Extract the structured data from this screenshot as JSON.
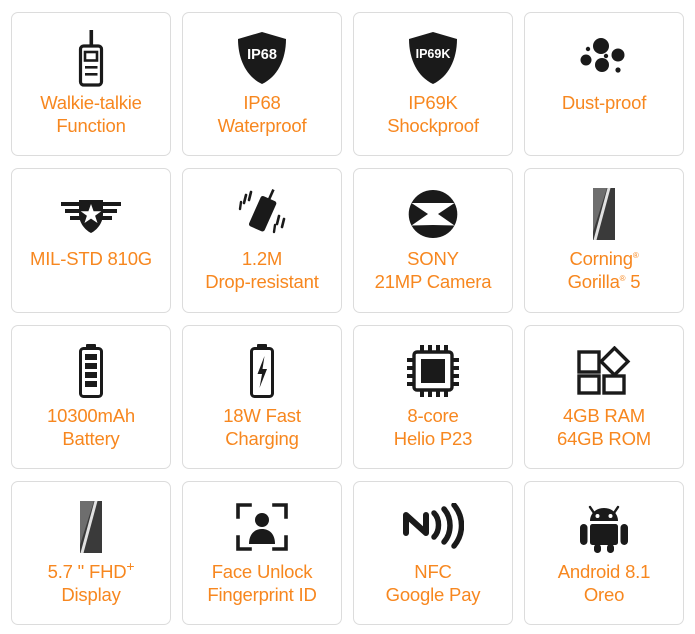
{
  "theme": {
    "accent_color": "#f7871f",
    "icon_color": "#1a1a1a",
    "card_border_color": "#dcdcdc",
    "background_color": "#ffffff"
  },
  "features": [
    {
      "icon": "walkie-talkie-icon",
      "line1": "Walkie-talkie",
      "line2": "Function",
      "badge_text": ""
    },
    {
      "icon": "shield-ip68-icon",
      "line1": "IP68",
      "line2": "Waterproof",
      "badge_text": "IP68"
    },
    {
      "icon": "shield-ip69k-icon",
      "line1": "IP69K",
      "line2": "Shockproof",
      "badge_text": "IP69K"
    },
    {
      "icon": "dust-particles-icon",
      "line1": "Dust-proof",
      "line2": "",
      "badge_text": ""
    },
    {
      "icon": "military-badge-icon",
      "line1": "MIL-STD 810G",
      "line2": "",
      "badge_text": ""
    },
    {
      "icon": "dropping-phone-icon",
      "line1": "1.2M",
      "line2": "Drop-resistant",
      "badge_text": ""
    },
    {
      "icon": "camera-aperture-icon",
      "line1": "SONY",
      "line2": "21MP Camera",
      "badge_text": ""
    },
    {
      "icon": "glass-panel-icon",
      "line1": "Corning",
      "line1_sup": "®",
      "line2": "Gorilla",
      "line2_sup": "®",
      "line2_suffix": " 5",
      "badge_text": ""
    },
    {
      "icon": "battery-full-icon",
      "line1": "10300mAh",
      "line2": "Battery",
      "badge_text": ""
    },
    {
      "icon": "battery-charging-icon",
      "line1": "18W Fast",
      "line2": "Charging",
      "badge_text": ""
    },
    {
      "icon": "cpu-chip-icon",
      "line1": "8-core",
      "line2": "Helio P23",
      "badge_text": ""
    },
    {
      "icon": "memory-blocks-icon",
      "line1": "4GB RAM",
      "line2": "64GB ROM",
      "badge_text": ""
    },
    {
      "icon": "display-panel-icon",
      "line1": "5.7 \" FHD",
      "line1_sup": "+",
      "line2": "Display",
      "badge_text": ""
    },
    {
      "icon": "face-unlock-icon",
      "line1": "Face Unlock",
      "line2": "Fingerprint ID",
      "badge_text": ""
    },
    {
      "icon": "nfc-wave-icon",
      "line1": "NFC",
      "line2": "Google Pay",
      "badge_text": ""
    },
    {
      "icon": "android-robot-icon",
      "line1": "Android 8.1",
      "line2": "Oreo",
      "badge_text": ""
    }
  ]
}
